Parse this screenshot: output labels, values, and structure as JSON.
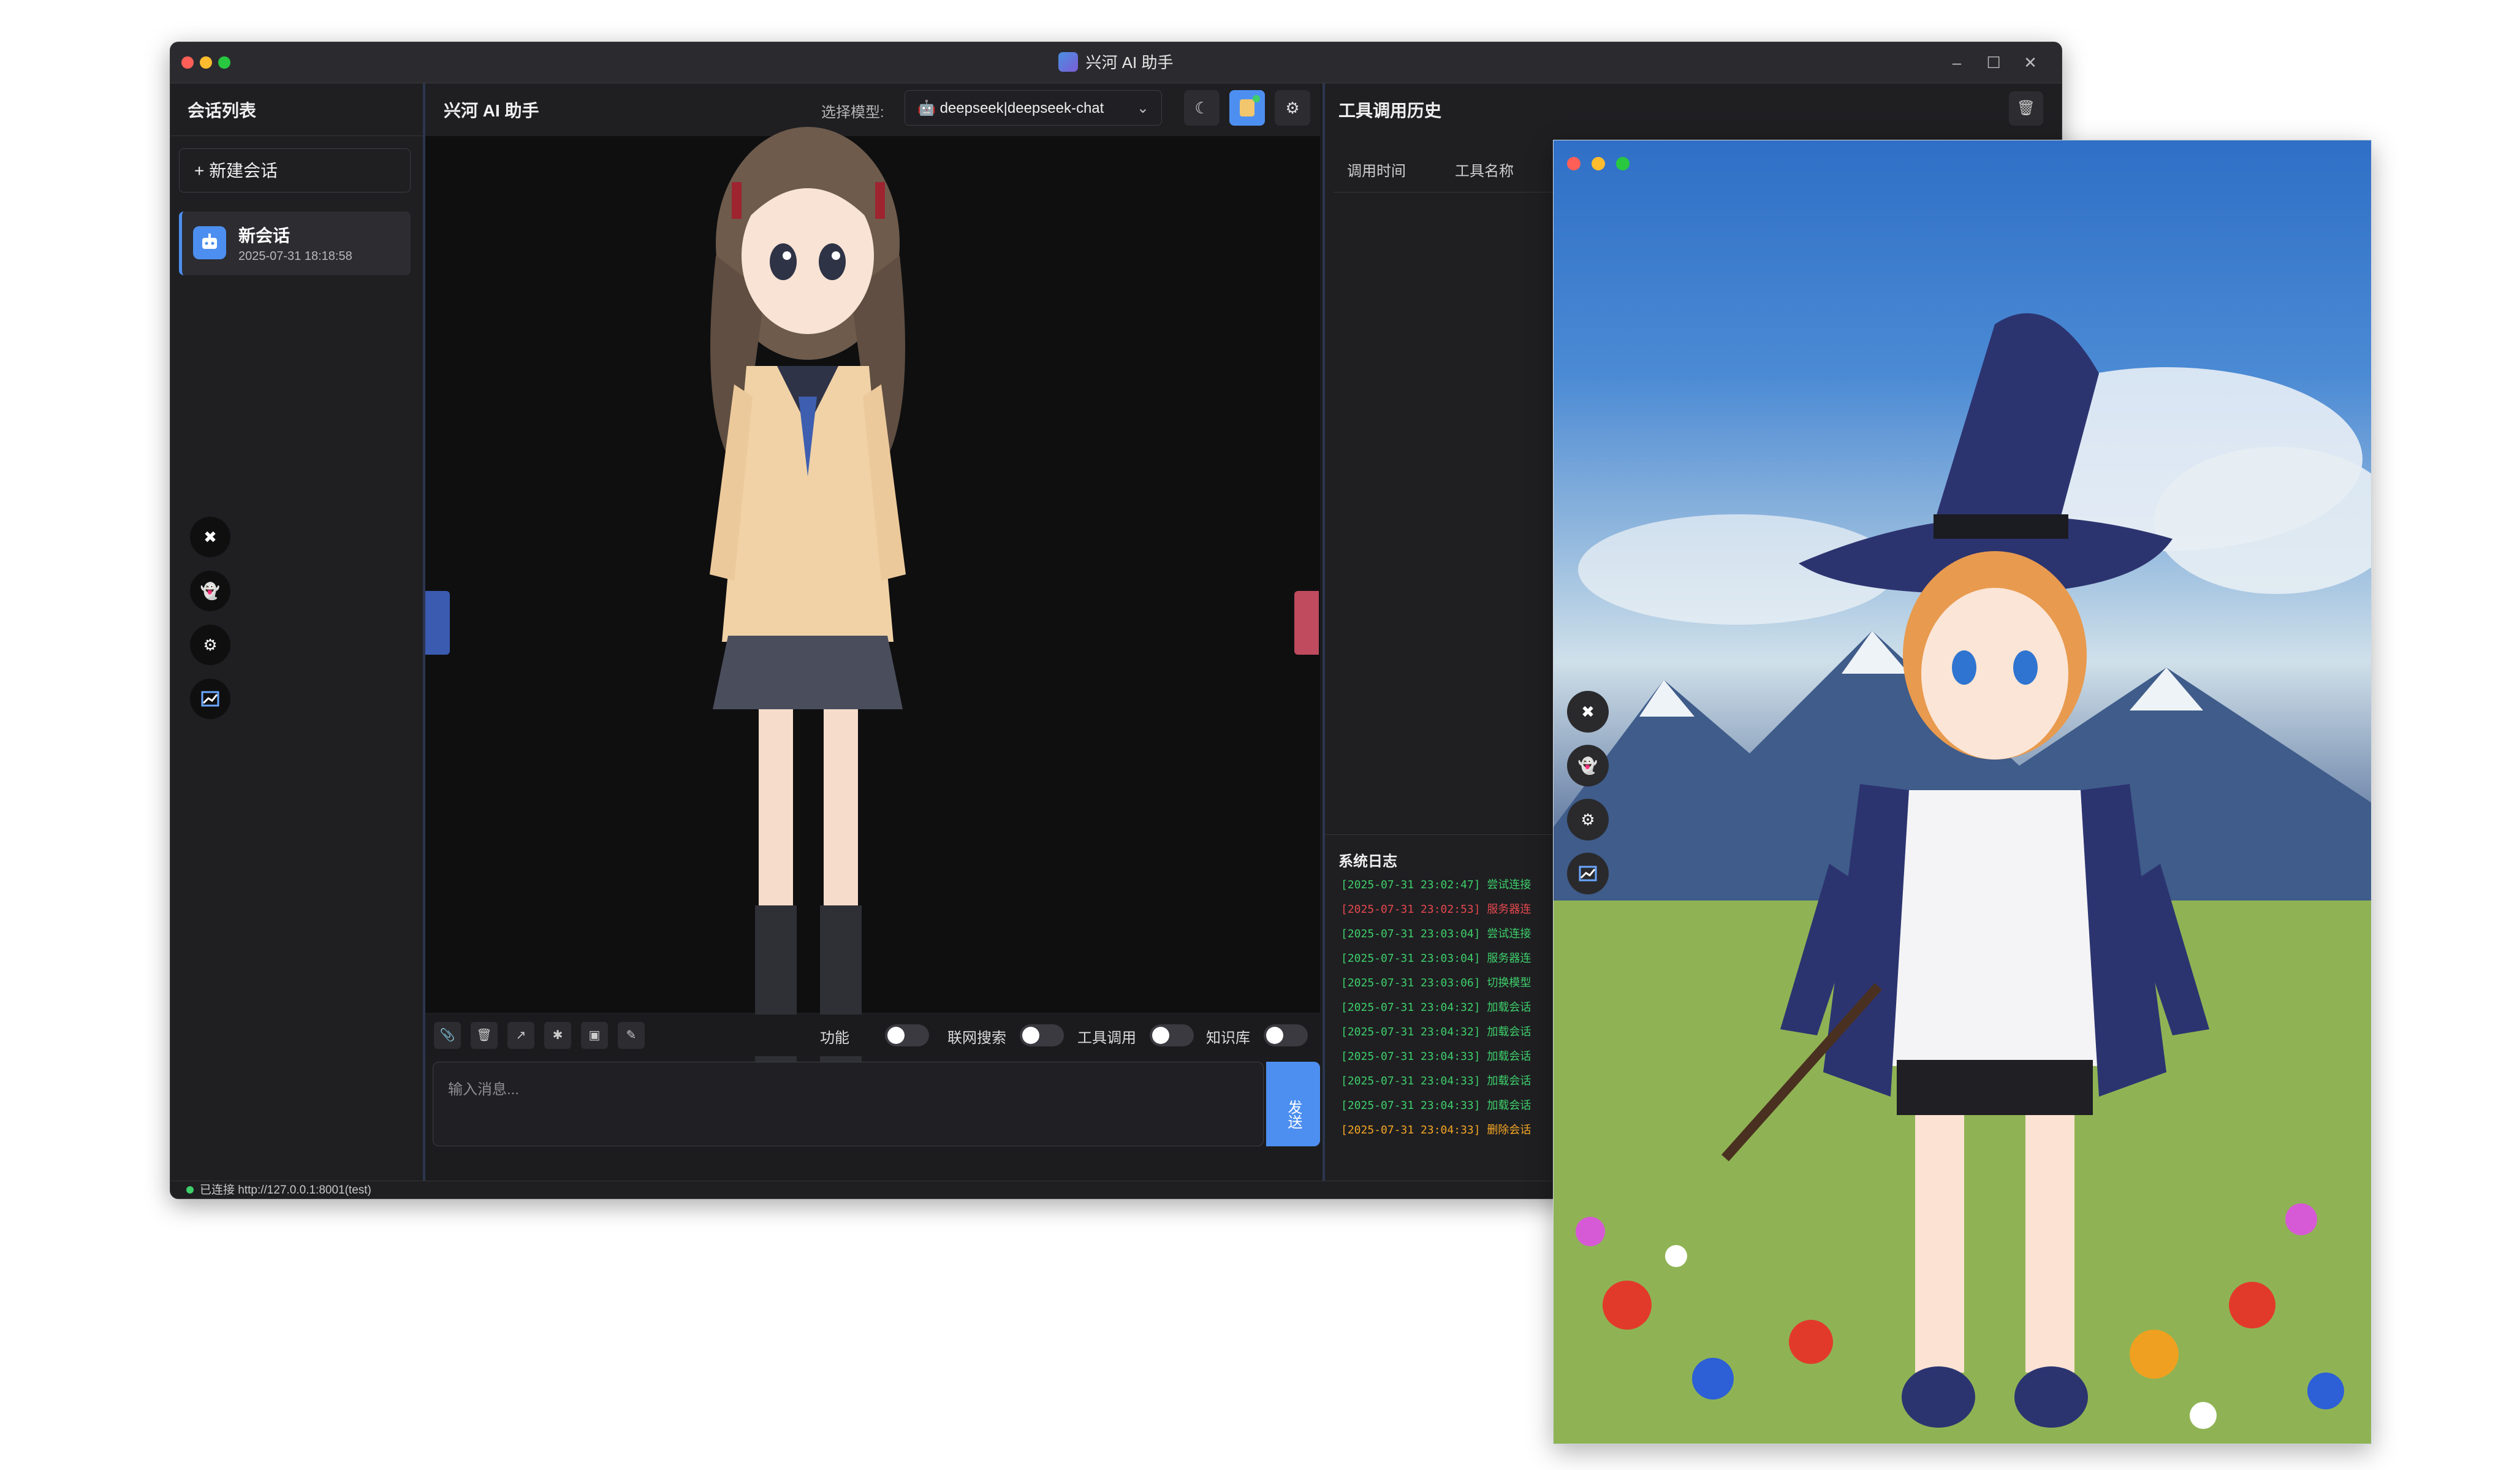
{
  "main_window": {
    "title": "兴河 AI 助手",
    "sidebar": {
      "header": "会话列表",
      "new_chat_label": "+ 新建会话",
      "sessions": [
        {
          "title": "新会话",
          "time": "2025-07-31 18:18:58"
        }
      ]
    },
    "chat": {
      "title": "兴河 AI 助手",
      "model_label": "选择模型:",
      "model_value": "deepseek|deepseek-chat",
      "input_placeholder": "输入消息...",
      "send_label": "发送",
      "toggles": [
        {
          "label": "功能",
          "on": false
        },
        {
          "label": "联网搜索",
          "on": false
        },
        {
          "label": "工具调用",
          "on": false
        },
        {
          "label": "知识库",
          "on": false
        }
      ]
    },
    "tools_panel": {
      "header": "工具调用历史",
      "columns": [
        "调用时间",
        "工具名称"
      ],
      "log_header": "系统日志",
      "logs": [
        {
          "time": "[2025-07-31 23:02:47]",
          "text": "尝试连接",
          "color": "#3ecf6a"
        },
        {
          "time": "[2025-07-31 23:02:53]",
          "text": "服务器连",
          "color": "#e5484d"
        },
        {
          "time": "[2025-07-31 23:03:04]",
          "text": "尝试连接",
          "color": "#3ecf6a"
        },
        {
          "time": "[2025-07-31 23:03:04]",
          "text": "服务器连",
          "color": "#3ecf6a"
        },
        {
          "time": "[2025-07-31 23:03:06]",
          "text": "切换模型",
          "color": "#3ecf6a"
        },
        {
          "time": "[2025-07-31 23:04:32]",
          "text": "加载会话",
          "color": "#3ecf6a"
        },
        {
          "time": "[2025-07-31 23:04:32]",
          "text": "加载会话",
          "color": "#3ecf6a"
        },
        {
          "time": "[2025-07-31 23:04:33]",
          "text": "加载会话",
          "color": "#3ecf6a"
        },
        {
          "time": "[2025-07-31 23:04:33]",
          "text": "加载会话",
          "color": "#3ecf6a"
        },
        {
          "time": "[2025-07-31 23:04:33]",
          "text": "加载会话",
          "color": "#3ecf6a"
        },
        {
          "time": "[2025-07-31 23:04:33]",
          "text": "删除会话",
          "color": "#f5a623"
        }
      ]
    },
    "status": "已连接 http://127.0.0.1:8001(test)"
  },
  "colors": {
    "accent": "#4d8ff0",
    "panel": "#1f1f22",
    "chat_bg": "#0f0f10",
    "success": "#3ecf6a",
    "error": "#e5484d",
    "warning": "#f5a623"
  },
  "icons": {
    "sidebar_fabs": [
      "close-icon",
      "ghost-icon",
      "gear-icon",
      "chart-icon"
    ],
    "chat_tools": [
      "paperclip-icon",
      "trash-icon",
      "wand-icon",
      "bug-icon",
      "robot-icon",
      "note-icon"
    ],
    "header_buttons": [
      "moon-icon",
      "character-icon",
      "gear-icon"
    ]
  }
}
